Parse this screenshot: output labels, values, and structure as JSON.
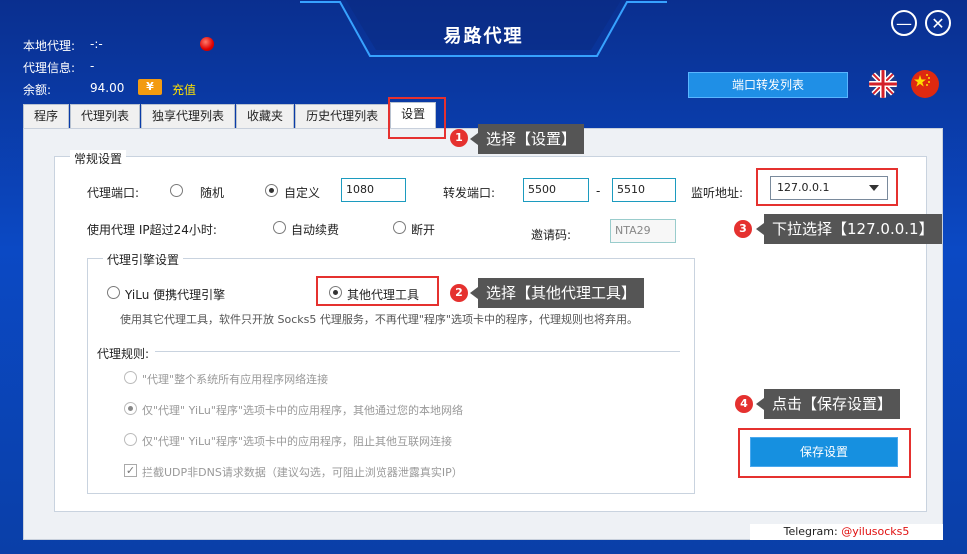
{
  "window": {
    "title": "易路代理"
  },
  "info": {
    "local_proxy_label": "本地代理:",
    "local_proxy_value": "-:-",
    "proxy_info_label": "代理信息:",
    "proxy_info_value": "-",
    "balance_label": "余额:",
    "balance_value": "94.00",
    "coin_glyph": "¥",
    "recharge_label": "充值"
  },
  "header": {
    "port_forward_button": "端口转发列表"
  },
  "tabs": [
    {
      "label": "程序"
    },
    {
      "label": "代理列表"
    },
    {
      "label": "独享代理列表"
    },
    {
      "label": "收藏夹"
    },
    {
      "label": "历史代理列表"
    },
    {
      "label": "设置",
      "active": true
    }
  ],
  "general": {
    "title": "常规设置",
    "proxy_port_label": "代理端口:",
    "random_label": "随机",
    "custom_label": "自定义",
    "custom_port_value": "1080",
    "forward_port_label": "转发端口:",
    "forward_from": "5500",
    "forward_dash": "-",
    "forward_to": "5510",
    "listen_label": "监听地址:",
    "listen_value": "127.0.0.1",
    "over24_label": "使用代理 IP超过24小时:",
    "auto_renew_label": "自动续费",
    "disconnect_label": "断开",
    "invite_label": "邀请码:",
    "invite_value": "NTA29"
  },
  "engine": {
    "title": "代理引擎设置",
    "yilu_label": "YiLu 便携代理引擎",
    "other_label": "其他代理工具",
    "desc": "使用其它代理工具，软件只开放 Socks5 代理服务，不再代理\"程序\"选项卡中的程序，代理规则也将弃用。",
    "rules_title": "代理规则:",
    "rule1": "\"代理\"整个系统所有应用程序网络连接",
    "rule2": "仅\"代理\" YiLu\"程序\"选项卡中的应用程序，其他通过您的本地网络",
    "rule3": "仅\"代理\" YiLu\"程序\"选项卡中的应用程序，阻止其他互联网连接",
    "udp_label": "拦截UDP非DNS请求数据（建议勾选，可阻止浏览器泄露真实IP）",
    "check_glyph": "✓"
  },
  "save_button": "保存设置",
  "callouts": [
    {
      "num": "1",
      "text": "选择【设置】"
    },
    {
      "num": "2",
      "text": "选择【其他代理工具】"
    },
    {
      "num": "3",
      "text": "下拉选择【127.0.0.1】"
    },
    {
      "num": "4",
      "text": "点击【保存设置】"
    }
  ],
  "footer": {
    "telegram_label": "Telegram:",
    "telegram_handle": "@yilusocks5"
  },
  "colors": {
    "accent": "#1690e0",
    "highlight": "#e5312f",
    "recharge": "#ffe200"
  }
}
